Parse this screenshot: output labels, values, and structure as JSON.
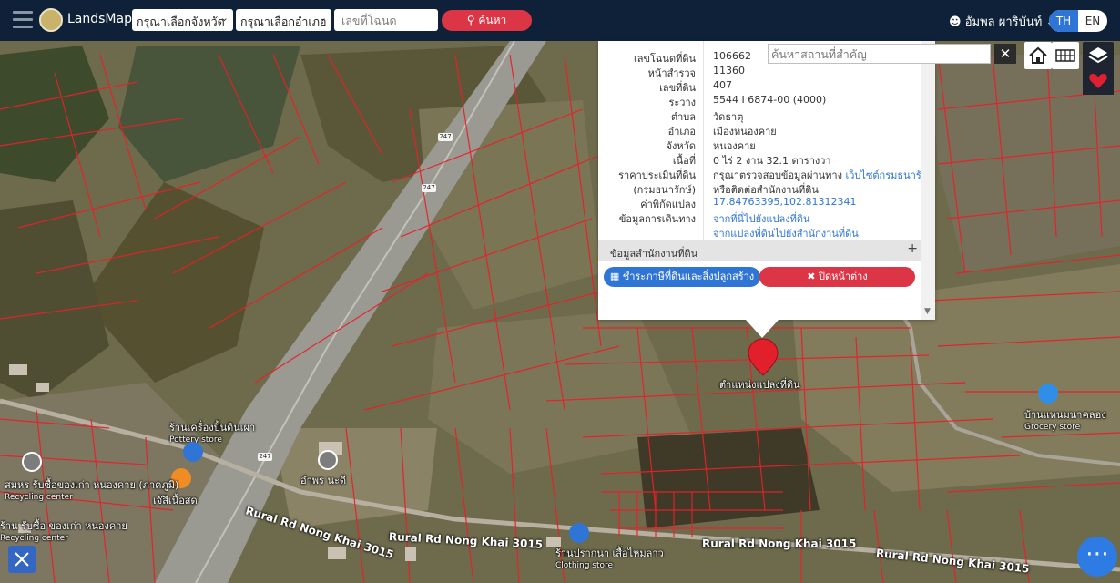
{
  "topbar": {
    "brand": "LandsMaps",
    "province_placeholder": "กรุณาเลือกจังหวัด",
    "district_placeholder": "กรุณาเลือกอำเภอ",
    "deed_placeholder": "เลขที่โฉนด",
    "search_label": "ค้นหา",
    "user_name": "อัมพล ผาริบันท์",
    "lang_th": "TH",
    "lang_en": "EN"
  },
  "parcel": {
    "rows": [
      {
        "label": "เลขโฉนดที่ดิน",
        "value": "106662"
      },
      {
        "label": "หน้าสำรวจ",
        "value": "11360"
      },
      {
        "label": "เลขที่ดิน",
        "value": "407"
      },
      {
        "label": "ระวาง",
        "value": "5544 I 6874-00 (4000)"
      },
      {
        "label": "ตำบล",
        "value": "วัดธาตุ"
      },
      {
        "label": "อำเภอ",
        "value": "เมืองหนองคาย"
      },
      {
        "label": "จังหวัด",
        "value": "หนองคาย"
      },
      {
        "label": "เนื้อที่",
        "value": "0 ไร่ 2 งาน 32.1 ตารางวา"
      }
    ],
    "price_label": "ราคาประเมินที่ดิน",
    "price_label2": "(กรมธนารักษ์)",
    "price_text": "กรุณาตรวจสอบข้อมูลผ่านทาง",
    "price_link": "เว็บไซต์กรมธนารักษ์",
    "price_text2": "หรือติดต่อสำนักงานที่ดิน",
    "coord_label": "ค่าพิกัดแปลง",
    "coord_value": "17.84763395,102.81312341",
    "travel_label": "ข้อมูลการเดินทาง",
    "travel_link1": "จากที่นี่ไปยังแปลงที่ดิน",
    "travel_link2": "จากแปลงที่ดินไปยังสำนักงานที่ดิน",
    "office_section": "ข้อมูลสำนักงานที่ดิน",
    "tax_button": "ชำระภาษีที่ดินและสิ่งปลูกสร้าง",
    "close_button": "ปิดหน้าต่าง"
  },
  "map": {
    "place_search_placeholder": "ค้นหาสถานที่สำคัญ",
    "marker_label": "ตำแหน่งแปลงที่ดิน",
    "route_shield": "247",
    "places": [
      {
        "name": "ร้านเครื่องปั้นดินเผา",
        "sub": "Pottery store"
      },
      {
        "name": "บ้านแหนมนาคลอง",
        "sub": "Grocery store"
      },
      {
        "name": "อำพร นะดี",
        "sub": ""
      },
      {
        "name": "เจ๊สีเนื้อสด",
        "sub": ""
      },
      {
        "name": "สมหร รับซื้อของเก่า หนองคาย (ภาคภูมิ)",
        "sub": "Recycling center"
      },
      {
        "name": "ร้าน รับซื้อ ของเก่า หนองคาย",
        "sub": "Recycling center"
      },
      {
        "name": "ร้านปรากนา เสื้อไหมลาว",
        "sub": "Clothing store"
      }
    ],
    "roads": [
      "Rural Rd Nong Khai 3015",
      "Rural Rd Nong Khai 3015",
      "Rural Rd Nong Khai 3015",
      "Rural Rd Nong Khai 3015"
    ]
  }
}
